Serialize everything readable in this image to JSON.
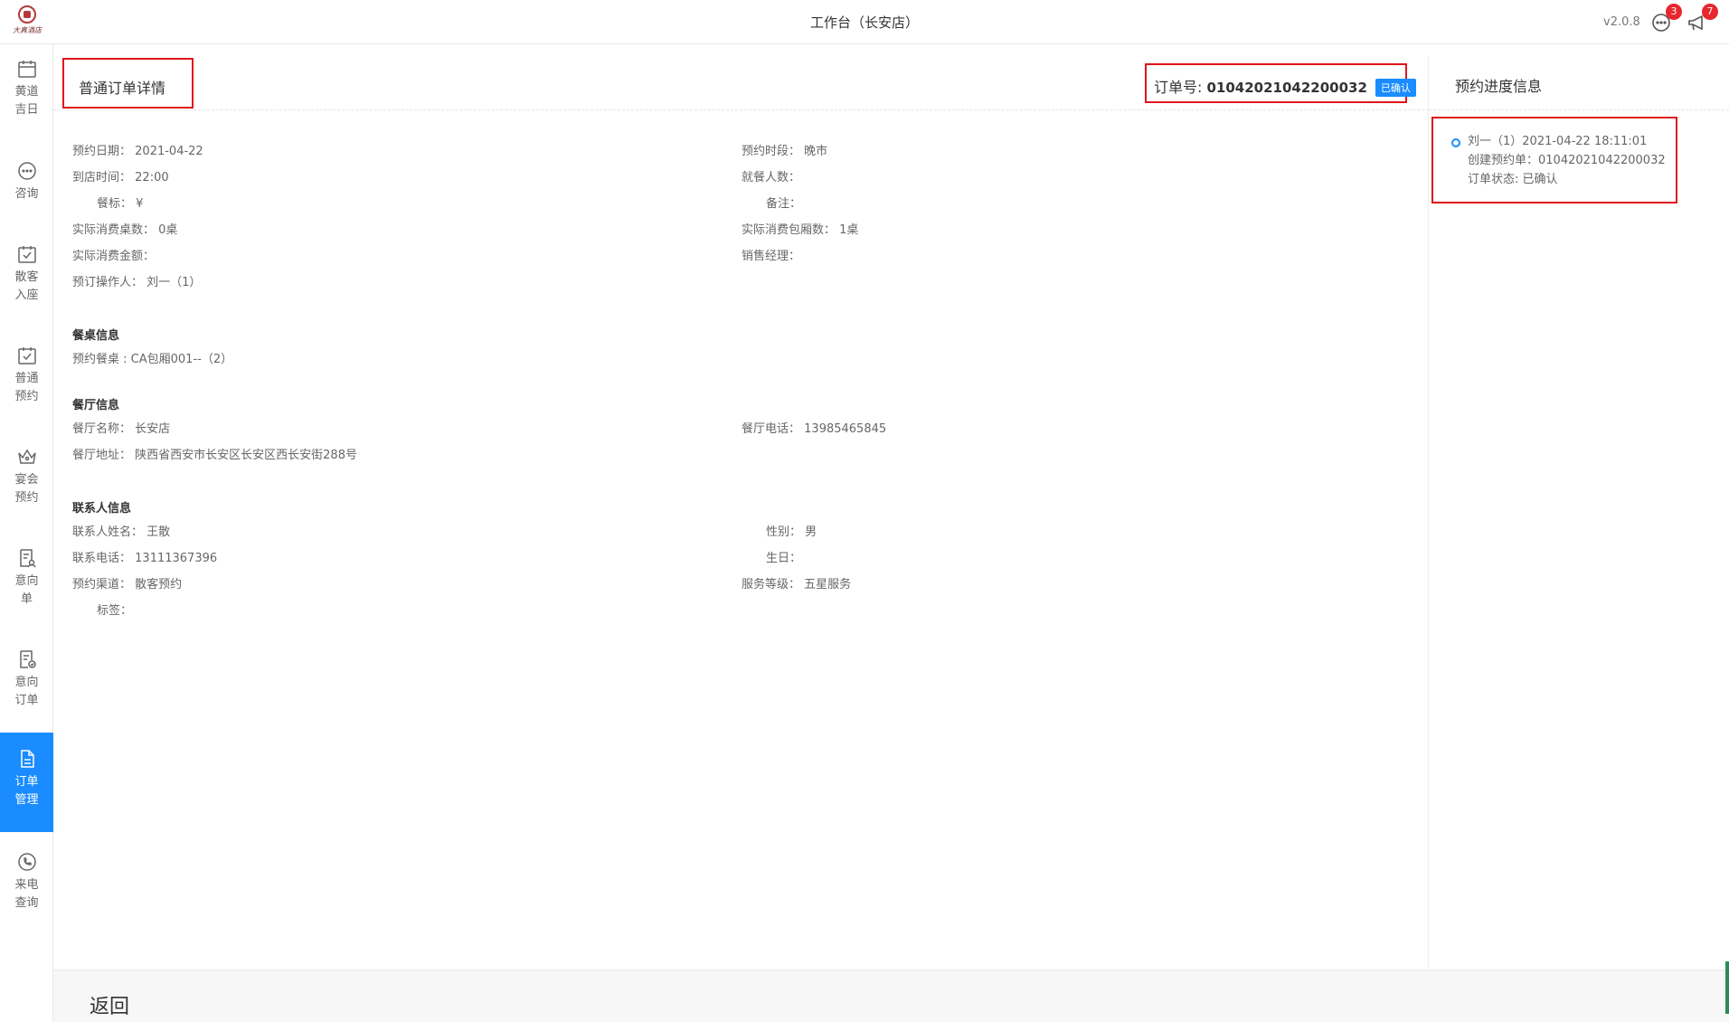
{
  "header": {
    "brand": "大真酒店",
    "title": "工作台（长安店）",
    "version": "v2.0.8",
    "messages_badge": "3",
    "announcements_badge": "7"
  },
  "sidebar": {
    "items": [
      {
        "line1": "黄道",
        "line2": "吉日",
        "icon": "calendar-icon"
      },
      {
        "line1": "咨询",
        "line2": "",
        "icon": "chat-icon"
      },
      {
        "line1": "散客",
        "line2": "入座",
        "icon": "calendar-check-icon"
      },
      {
        "line1": "普通",
        "line2": "预约",
        "icon": "calendar-check-icon"
      },
      {
        "line1": "宴会",
        "line2": "预约",
        "icon": "crown-icon"
      },
      {
        "line1": "意向",
        "line2": "单",
        "icon": "document-user-icon"
      },
      {
        "line1": "意向",
        "line2": "订单",
        "icon": "document-check-icon"
      },
      {
        "line1": "订单",
        "line2": "管理",
        "icon": "document-icon",
        "active": true
      },
      {
        "line1": "来电",
        "line2": "查询",
        "icon": "phone-icon"
      }
    ]
  },
  "main": {
    "title": "普通订单详情",
    "order_label": "订单号:",
    "order_number": "01042021042200032",
    "order_status": "已确认",
    "basic": {
      "date_label": "预约日期：",
      "date_value": "2021-04-22",
      "period_label": "预约时段：",
      "period_value": "晚市",
      "arrival_label": "到店时间：",
      "arrival_value": "22:00",
      "diners_label": "就餐人数：",
      "diners_value": "",
      "standard_label": "餐标：",
      "standard_value": "¥",
      "remark_label": "备注：",
      "remark_value": "",
      "tables_label": "实际消费桌数：",
      "tables_value": "0桌",
      "rooms_label": "实际消费包厢数：",
      "rooms_value": "1桌",
      "amount_label": "实际消费金额：",
      "amount_value": "",
      "sales_label": "销售经理：",
      "sales_value": "",
      "operator_label": "预订操作人：",
      "operator_value": "刘一（1）"
    },
    "table_info": {
      "title": "餐桌信息",
      "reserved_label": "预约餐桌 :",
      "reserved_value": "CA包厢001--（2）"
    },
    "restaurant_info": {
      "title": "餐厅信息",
      "name_label": "餐厅名称：",
      "name_value": "长安店",
      "phone_label": "餐厅电话：",
      "phone_value": "13985465845",
      "address_label": "餐厅地址：",
      "address_value": "陕西省西安市长安区长安区西长安街288号"
    },
    "contact_info": {
      "title": "联系人信息",
      "name_label": "联系人姓名：",
      "name_value": "王散",
      "gender_label": "性别：",
      "gender_value": "男",
      "phone_label": "联系电话：",
      "phone_value": "13111367396",
      "birthday_label": "生日：",
      "birthday_value": "",
      "channel_label": "预约渠道：",
      "channel_value": "散客预约",
      "level_label": "服务等级：",
      "level_value": "五星服务",
      "tags_label": "标签：",
      "tags_value": ""
    }
  },
  "progress": {
    "title": "预约进度信息",
    "line1": "刘一（1）2021-04-22 18:11:01",
    "line2": "创建预约单：01042021042200032",
    "line3": "订单状态: 已确认"
  },
  "footer": {
    "back_label": "返回"
  },
  "colors": {
    "accent": "#1a8cff",
    "highlight_border": "#e0151b",
    "badge": "#e8262e"
  }
}
